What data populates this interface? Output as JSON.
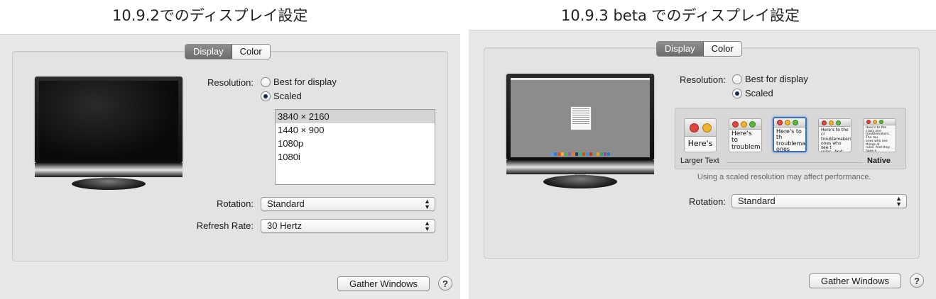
{
  "left": {
    "heading": "10.9.2でのディスプレイ設定",
    "tabs": [
      "Display",
      "Color"
    ],
    "resolution_label": "Resolution:",
    "radio_best": "Best for display",
    "radio_scaled": "Scaled",
    "resolutions": [
      "3840 × 2160",
      "1440 × 900",
      "1080p",
      "1080i"
    ],
    "rotation_label": "Rotation:",
    "rotation_value": "Standard",
    "refresh_label": "Refresh Rate:",
    "refresh_value": "30 Hertz",
    "gather_button": "Gather Windows",
    "help_button": "?"
  },
  "right": {
    "heading": "10.9.3 beta でのディスプレイ設定",
    "tabs": [
      "Display",
      "Color"
    ],
    "resolution_label": "Resolution:",
    "radio_best": "Best for display",
    "radio_scaled": "Scaled",
    "scaled_options": [
      {
        "text": "Here's"
      },
      {
        "text": "Here's to\ntroublem"
      },
      {
        "text": "Here's to th\ntroublemak\nones who s"
      },
      {
        "text": "Here's to the cr\ntroublemakers.\nones who see t\nrules. And they"
      },
      {
        "text": "Here's to the crazy one\ntroublemakers. The rou\nones who see things di\nrules. And they have n\nthem. About the only th\nBecause they change t"
      }
    ],
    "selected_option_index": 2,
    "larger_text_label": "Larger Text",
    "native_label": "Native",
    "scaled_note": "Using a scaled resolution may affect performance.",
    "rotation_label": "Rotation:",
    "rotation_value": "Standard",
    "gather_button": "Gather Windows",
    "help_button": "?"
  },
  "colors": {
    "panel_bg": "#e8e8e8",
    "selected_tab": "#7c7c7c",
    "selected_option_border": "#3d6fb4",
    "list_selection": "#d4d4d4"
  }
}
